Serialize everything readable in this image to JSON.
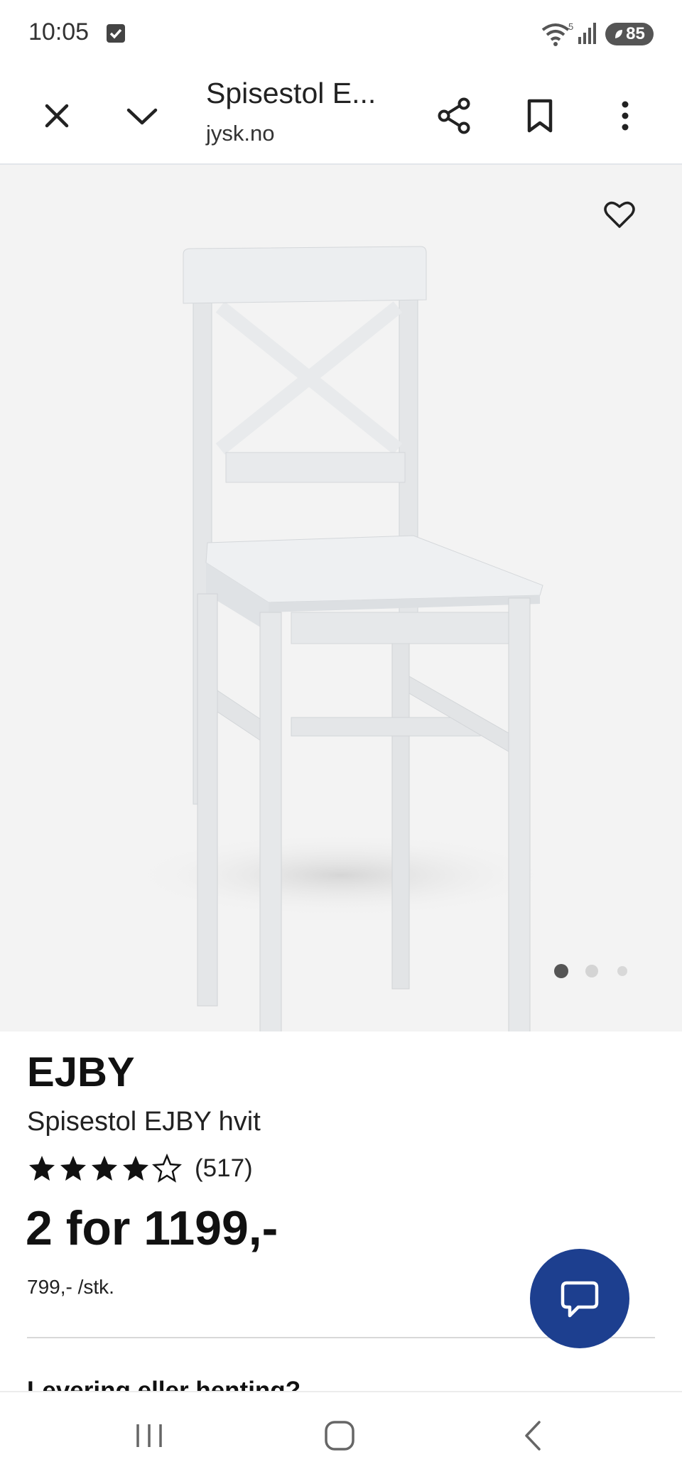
{
  "status_bar": {
    "time": "10:05",
    "battery": "85",
    "wifi_badge": "5"
  },
  "browser": {
    "title": "Spisestol E...",
    "domain": "jysk.no"
  },
  "product": {
    "brand": "EJBY",
    "name": "Spisestol EJBY hvit",
    "rating": 4,
    "rating_max": 5,
    "review_count": "(517)",
    "price": "2 for 1199,-",
    "unit_price": "799,- /stk.",
    "image_count": 3,
    "active_image": 1
  },
  "section": {
    "delivery_heading": "Levering eller henting?"
  },
  "colors": {
    "fab": "#1d3f8f",
    "hero_bg": "#f3f3f3"
  }
}
